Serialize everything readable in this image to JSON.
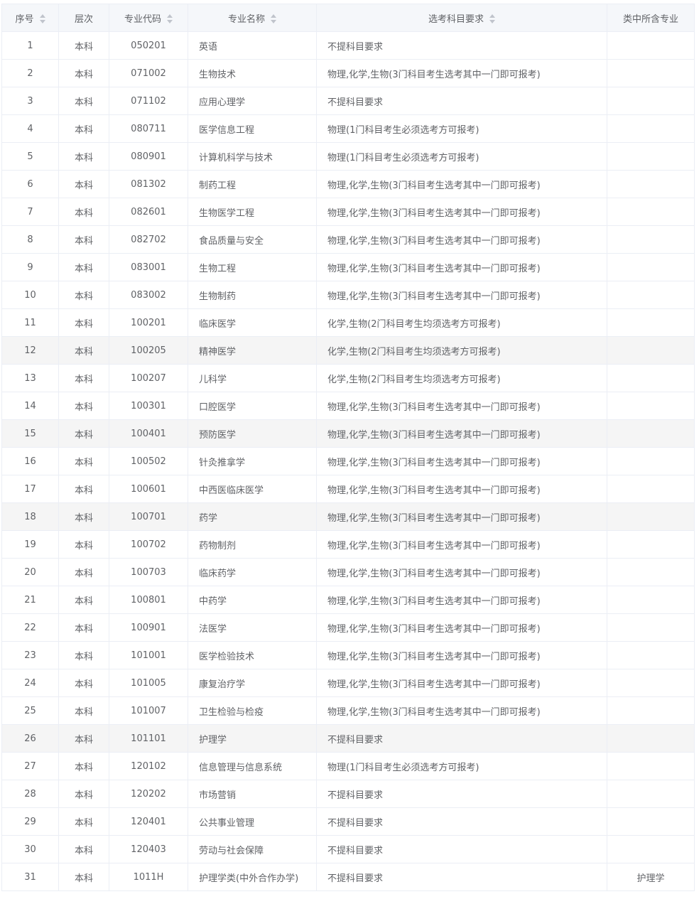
{
  "headers": [
    {
      "key": "seq",
      "label": "序号",
      "sortable": true
    },
    {
      "key": "level",
      "label": "层次",
      "sortable": false
    },
    {
      "key": "code",
      "label": "专业代码",
      "sortable": true
    },
    {
      "key": "name",
      "label": "专业名称",
      "sortable": true
    },
    {
      "key": "req",
      "label": "选考科目要求",
      "sortable": true
    },
    {
      "key": "sub",
      "label": "类中所含专业",
      "sortable": false
    }
  ],
  "highlighted_rows": [
    12,
    15,
    18,
    26
  ],
  "rows": [
    {
      "seq": "1",
      "level": "本科",
      "code": "050201",
      "name": "英语",
      "req": "不提科目要求",
      "sub": ""
    },
    {
      "seq": "2",
      "level": "本科",
      "code": "071002",
      "name": "生物技术",
      "req": "物理,化学,生物(3门科目考生选考其中一门即可报考)",
      "sub": ""
    },
    {
      "seq": "3",
      "level": "本科",
      "code": "071102",
      "name": "应用心理学",
      "req": "不提科目要求",
      "sub": ""
    },
    {
      "seq": "4",
      "level": "本科",
      "code": "080711",
      "name": "医学信息工程",
      "req": "物理(1门科目考生必须选考方可报考)",
      "sub": ""
    },
    {
      "seq": "5",
      "level": "本科",
      "code": "080901",
      "name": "计算机科学与技术",
      "req": "物理(1门科目考生必须选考方可报考)",
      "sub": ""
    },
    {
      "seq": "6",
      "level": "本科",
      "code": "081302",
      "name": "制药工程",
      "req": "物理,化学,生物(3门科目考生选考其中一门即可报考)",
      "sub": ""
    },
    {
      "seq": "7",
      "level": "本科",
      "code": "082601",
      "name": "生物医学工程",
      "req": "物理,化学,生物(3门科目考生选考其中一门即可报考)",
      "sub": ""
    },
    {
      "seq": "8",
      "level": "本科",
      "code": "082702",
      "name": "食品质量与安全",
      "req": "物理,化学,生物(3门科目考生选考其中一门即可报考)",
      "sub": ""
    },
    {
      "seq": "9",
      "level": "本科",
      "code": "083001",
      "name": "生物工程",
      "req": "物理,化学,生物(3门科目考生选考其中一门即可报考)",
      "sub": ""
    },
    {
      "seq": "10",
      "level": "本科",
      "code": "083002",
      "name": "生物制药",
      "req": "物理,化学,生物(3门科目考生选考其中一门即可报考)",
      "sub": ""
    },
    {
      "seq": "11",
      "level": "本科",
      "code": "100201",
      "name": "临床医学",
      "req": "化学,生物(2门科目考生均须选考方可报考)",
      "sub": ""
    },
    {
      "seq": "12",
      "level": "本科",
      "code": "100205",
      "name": "精神医学",
      "req": "化学,生物(2门科目考生均须选考方可报考)",
      "sub": ""
    },
    {
      "seq": "13",
      "level": "本科",
      "code": "100207",
      "name": "儿科学",
      "req": "化学,生物(2门科目考生均须选考方可报考)",
      "sub": ""
    },
    {
      "seq": "14",
      "level": "本科",
      "code": "100301",
      "name": "口腔医学",
      "req": "物理,化学,生物(3门科目考生选考其中一门即可报考)",
      "sub": ""
    },
    {
      "seq": "15",
      "level": "本科",
      "code": "100401",
      "name": "预防医学",
      "req": "物理,化学,生物(3门科目考生选考其中一门即可报考)",
      "sub": ""
    },
    {
      "seq": "16",
      "level": "本科",
      "code": "100502",
      "name": "针灸推拿学",
      "req": "物理,化学,生物(3门科目考生选考其中一门即可报考)",
      "sub": ""
    },
    {
      "seq": "17",
      "level": "本科",
      "code": "100601",
      "name": "中西医临床医学",
      "req": "物理,化学,生物(3门科目考生选考其中一门即可报考)",
      "sub": ""
    },
    {
      "seq": "18",
      "level": "本科",
      "code": "100701",
      "name": "药学",
      "req": "物理,化学,生物(3门科目考生选考其中一门即可报考)",
      "sub": ""
    },
    {
      "seq": "19",
      "level": "本科",
      "code": "100702",
      "name": "药物制剂",
      "req": "物理,化学,生物(3门科目考生选考其中一门即可报考)",
      "sub": ""
    },
    {
      "seq": "20",
      "level": "本科",
      "code": "100703",
      "name": "临床药学",
      "req": "物理,化学,生物(3门科目考生选考其中一门即可报考)",
      "sub": ""
    },
    {
      "seq": "21",
      "level": "本科",
      "code": "100801",
      "name": "中药学",
      "req": "物理,化学,生物(3门科目考生选考其中一门即可报考)",
      "sub": ""
    },
    {
      "seq": "22",
      "level": "本科",
      "code": "100901",
      "name": "法医学",
      "req": "物理,化学,生物(3门科目考生选考其中一门即可报考)",
      "sub": ""
    },
    {
      "seq": "23",
      "level": "本科",
      "code": "101001",
      "name": "医学检验技术",
      "req": "物理,化学,生物(3门科目考生选考其中一门即可报考)",
      "sub": ""
    },
    {
      "seq": "24",
      "level": "本科",
      "code": "101005",
      "name": "康复治疗学",
      "req": "物理,化学,生物(3门科目考生选考其中一门即可报考)",
      "sub": ""
    },
    {
      "seq": "25",
      "level": "本科",
      "code": "101007",
      "name": "卫生检验与检疫",
      "req": "物理,化学,生物(3门科目考生选考其中一门即可报考)",
      "sub": ""
    },
    {
      "seq": "26",
      "level": "本科",
      "code": "101101",
      "name": "护理学",
      "req": "不提科目要求",
      "sub": ""
    },
    {
      "seq": "27",
      "level": "本科",
      "code": "120102",
      "name": "信息管理与信息系统",
      "req": "物理(1门科目考生必须选考方可报考)",
      "sub": ""
    },
    {
      "seq": "28",
      "level": "本科",
      "code": "120202",
      "name": "市场营销",
      "req": "不提科目要求",
      "sub": ""
    },
    {
      "seq": "29",
      "level": "本科",
      "code": "120401",
      "name": "公共事业管理",
      "req": "不提科目要求",
      "sub": ""
    },
    {
      "seq": "30",
      "level": "本科",
      "code": "120403",
      "name": "劳动与社会保障",
      "req": "不提科目要求",
      "sub": ""
    },
    {
      "seq": "31",
      "level": "本科",
      "code": "1011H",
      "name": "护理学类(中外合作办学)",
      "req": "不提科目要求",
      "sub": "护理学"
    }
  ]
}
